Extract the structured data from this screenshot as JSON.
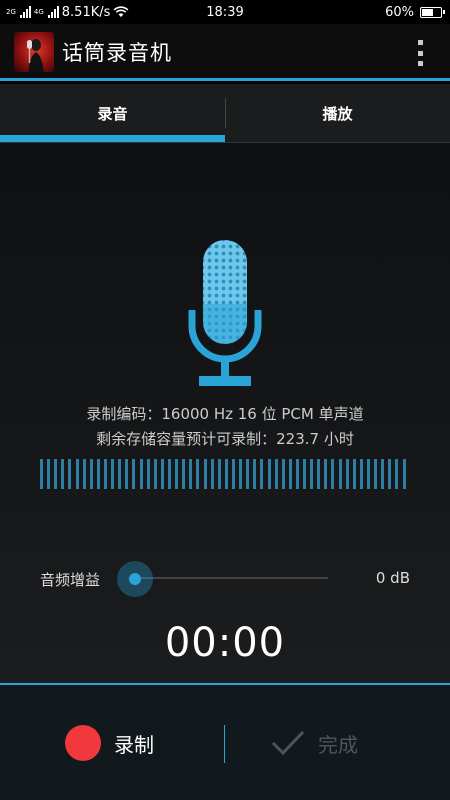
{
  "status_bar": {
    "network_speed": "8.51K/s",
    "time": "18:39",
    "battery": "60%",
    "battery_level": 0.6,
    "network_type_1": "2G",
    "network_type_2": "4G"
  },
  "app_bar": {
    "title": "话筒录音机",
    "app_icon": "microphone-singer-icon",
    "menu_icon": "overflow-menu-icon"
  },
  "tabs": [
    {
      "label": "录音",
      "selected": true
    },
    {
      "label": "播放",
      "selected": false
    }
  ],
  "recorder": {
    "mic_icon": "microphone-icon",
    "codec": "录制编码：16000 Hz 16 位 PCM 单声道",
    "remaining": "剩余存储容量预计可录制：223.7 小时",
    "gain_label": "音频增益",
    "gain_value": "0 dB",
    "gain_level": 0.0,
    "timer": "00:00"
  },
  "bottom_bar": {
    "record_label": "录制",
    "done_label": "完成",
    "done_icon": "checkmark-icon"
  },
  "colors": {
    "accent": "#2aa3d6",
    "record": "#f0383d",
    "disabled": "#4b5658"
  }
}
